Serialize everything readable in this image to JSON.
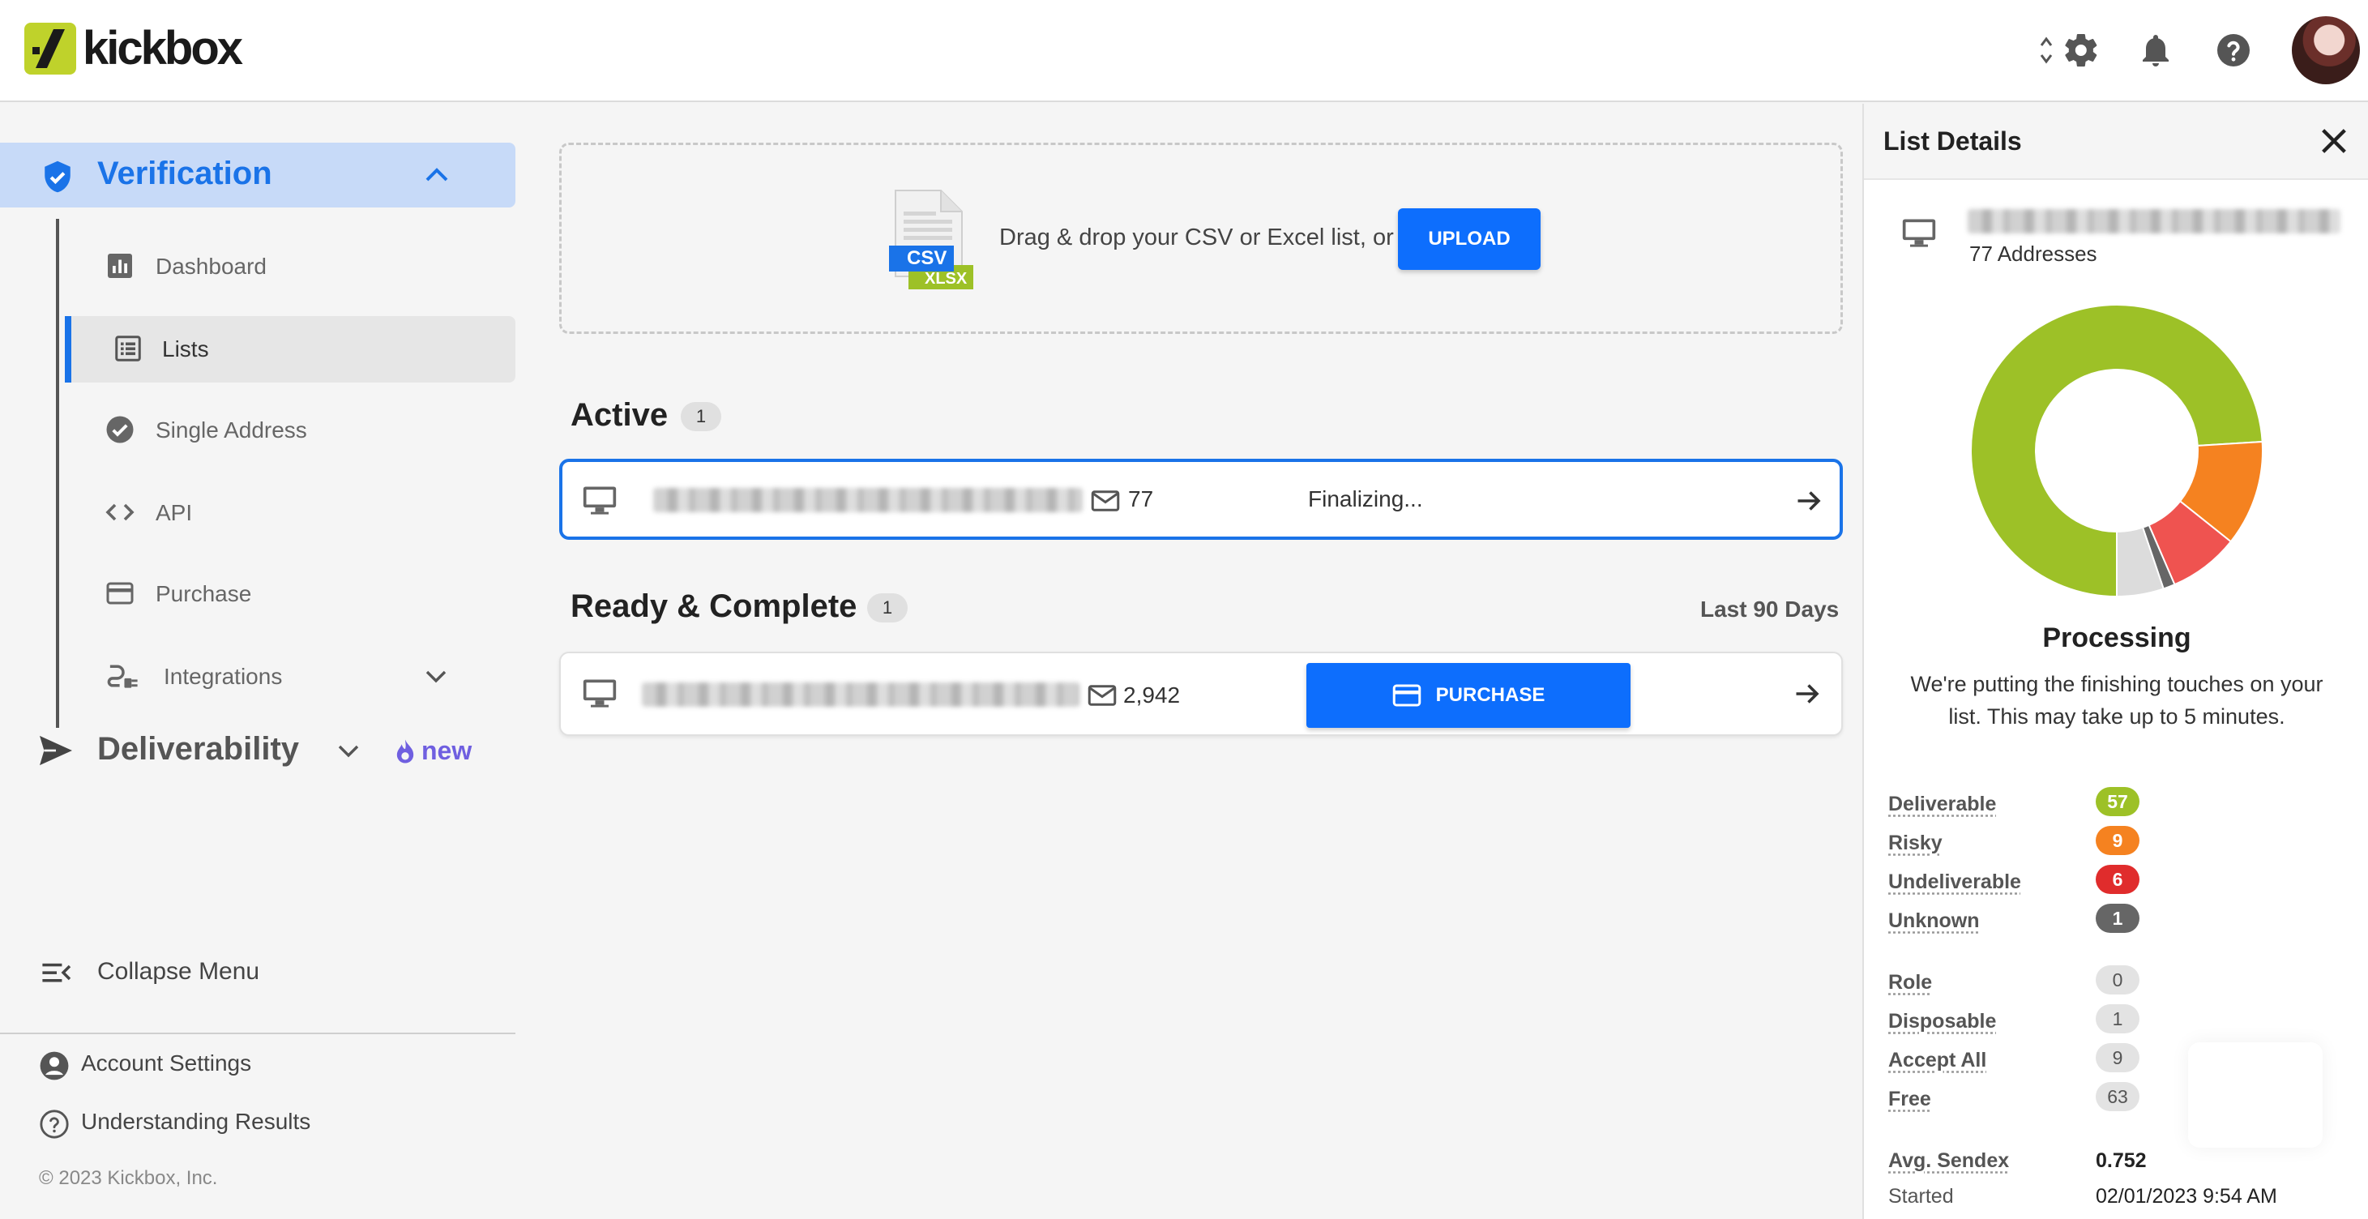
{
  "brand": {
    "name": "kickbox",
    "accent": "#bfd22b"
  },
  "colors": {
    "primary": "#1a73e8",
    "button": "#0d6efd",
    "deliverable": "#9dc127",
    "risky": "#f58220",
    "undeliverable": "#e02c2c",
    "unknown": "#666666"
  },
  "header": {
    "icons": [
      "sort-icon",
      "gear-icon",
      "bell-icon",
      "help-icon"
    ]
  },
  "sidebar": {
    "verification": "Verification",
    "items": [
      {
        "label": "Dashboard",
        "icon": "chart-icon"
      },
      {
        "label": "Lists",
        "icon": "list-icon",
        "active": true
      },
      {
        "label": "Single Address",
        "icon": "check-circle-icon"
      },
      {
        "label": "API",
        "icon": "code-icon"
      },
      {
        "label": "Purchase",
        "icon": "credit-card-icon"
      },
      {
        "label": "Integrations",
        "icon": "plug-icon"
      }
    ],
    "deliverability": "Deliverability",
    "new_badge": "new",
    "collapse": "Collapse Menu",
    "account_settings": "Account Settings",
    "understanding_results": "Understanding Results",
    "copyright": "© 2023 Kickbox, Inc."
  },
  "upload": {
    "text": "Drag & drop your CSV or Excel list, or",
    "button": "UPLOAD",
    "csv": "CSV",
    "xlsx": "XLSX"
  },
  "active": {
    "title": "Active",
    "count": "1",
    "row": {
      "count": "77",
      "status": "Finalizing..."
    }
  },
  "complete": {
    "title": "Ready & Complete",
    "count": "1",
    "range": "Last 90 Days",
    "row": {
      "count": "2,942",
      "button": "PURCHASE"
    }
  },
  "panel": {
    "title": "List Details",
    "addresses": "77 Addresses",
    "processing": "Processing",
    "processing_desc": "We're putting the finishing touches on your list. This may take up to 5 minutes.",
    "stats": [
      {
        "label": "Deliverable",
        "value": "57",
        "color": "#9dc127"
      },
      {
        "label": "Risky",
        "value": "9",
        "color": "#f58220"
      },
      {
        "label": "Undeliverable",
        "value": "6",
        "color": "#e02c2c"
      },
      {
        "label": "Unknown",
        "value": "1",
        "color": "#666666"
      }
    ],
    "attributes": [
      {
        "label": "Role",
        "value": "0"
      },
      {
        "label": "Disposable",
        "value": "1"
      },
      {
        "label": "Accept All",
        "value": "9"
      },
      {
        "label": "Free",
        "value": "63"
      }
    ],
    "sendex_label": "Avg. Sendex",
    "sendex_value": "0.752",
    "started_label": "Started",
    "started_value": "02/01/2023 9:54 AM"
  }
}
